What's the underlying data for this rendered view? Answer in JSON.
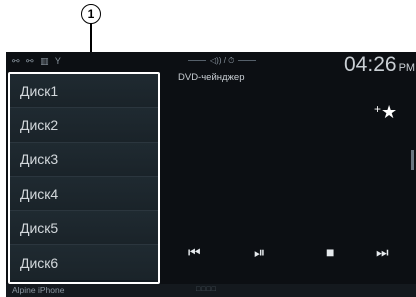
{
  "callout": {
    "number": "1"
  },
  "status": {
    "icons": "⚯ ⚯ ▥ Y",
    "center_icons": "◁)) / ⏱",
    "time": "04:26",
    "ampm": "PM"
  },
  "disc_list": [
    "Диск1",
    "Диск2",
    "Диск3",
    "Диск4",
    "Диск5",
    "Диск6"
  ],
  "source_title": "DVD-чейнджер",
  "favorite": {
    "icon": "star-plus",
    "label": "★",
    "plus": "+"
  },
  "controls": {
    "prev": "⏮",
    "play_pause": "⏯",
    "stop": "■",
    "next": "⏭"
  },
  "footer": {
    "source_name": "Alpine iPhone",
    "page_dots": "□□□□"
  }
}
